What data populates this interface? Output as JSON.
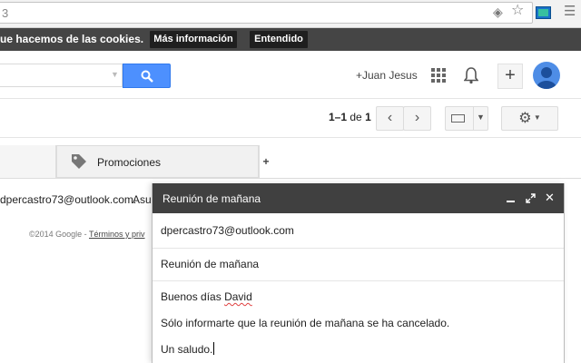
{
  "browser": {
    "url_fragment": "3",
    "icons": [
      "stack-icon",
      "star-icon",
      "extension-icon",
      "menu-icon"
    ]
  },
  "cookie_bar": {
    "text": "ue hacemos de las cookies.",
    "more_info_label": "Más información",
    "ok_label": "Entendido"
  },
  "header": {
    "user_link": "+Juan Jesus",
    "accent_color": "#4d90fe"
  },
  "toolbar": {
    "pager_range": "1–1",
    "pager_of": "de",
    "pager_total": "1"
  },
  "tabs": [
    {
      "label": "Promociones",
      "icon": "tag-icon"
    }
  ],
  "tab_add_label": "+",
  "email_row": {
    "from": "dpercastro73@outlook.com.",
    "subject_fragment": "Asun"
  },
  "footer": {
    "copyright": "©2014 Google - ",
    "terms_fragment": "Términos y priv"
  },
  "compose": {
    "title": "Reunión de mañana",
    "to": "dpercastro73@outlook.com",
    "subject": "Reunión de mañana",
    "body": {
      "greeting_prefix": "Buenos días ",
      "greeting_name": "David",
      "line2": "Sólo informarte que la reunión de mañana se ha cancelado.",
      "line3": "Un saludo."
    }
  }
}
